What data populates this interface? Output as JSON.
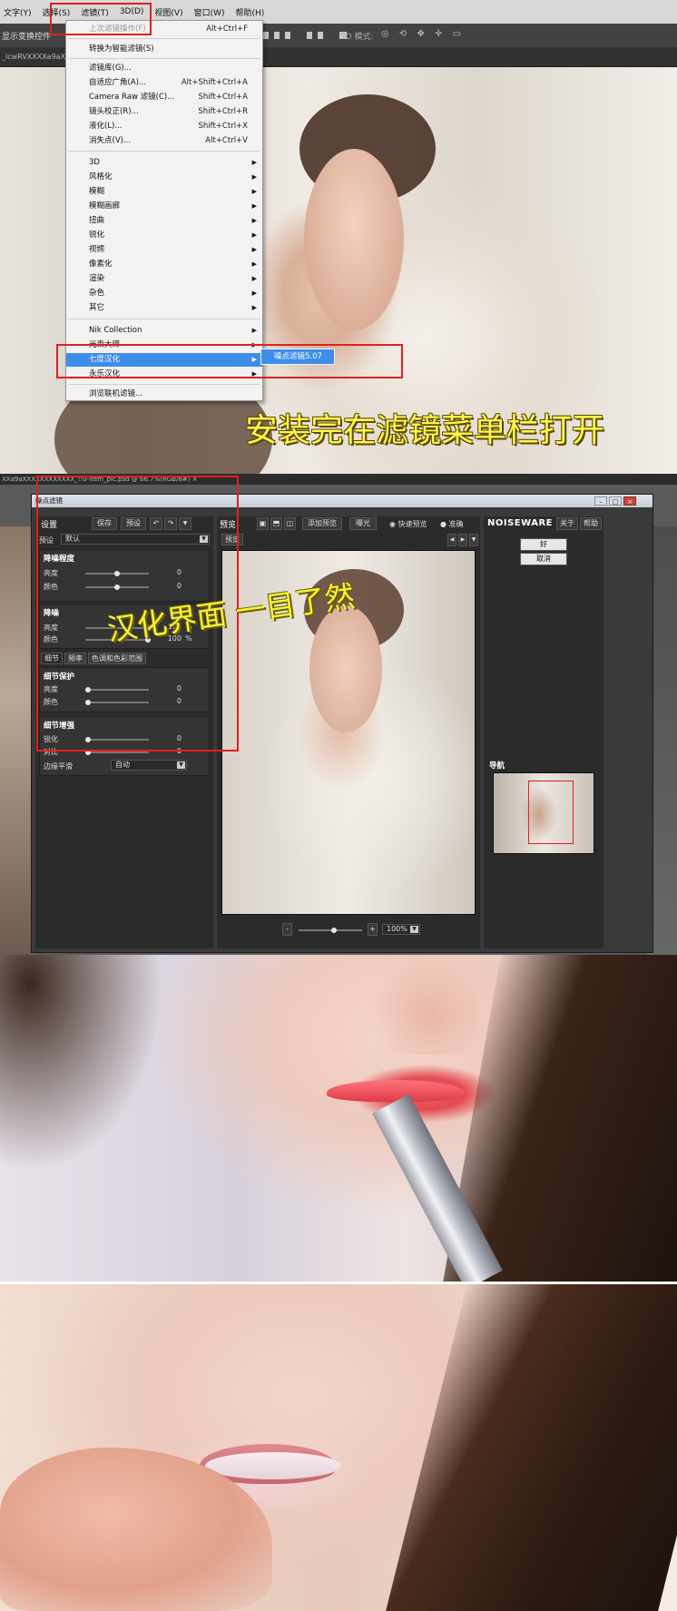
{
  "section1": {
    "menubar": [
      "文字(Y)",
      "选择(S)",
      "滤镜(T)",
      "3D(D)",
      "视图(V)",
      "窗口(W)",
      "帮助(H)"
    ],
    "optbar": {
      "label": "显示变换控件",
      "mode_label": "3D 模式:"
    },
    "doctab": "_lcwRVXXXXa9aXXX",
    "menu": {
      "last_filter": {
        "label": "上次滤镜操作(F)",
        "shortcut": "Alt+Ctrl+F"
      },
      "smart": "转换为智能滤镜(S)",
      "gallery": "滤镜库(G)...",
      "adaptive": {
        "label": "自适应广角(A)...",
        "shortcut": "Alt+Shift+Ctrl+A"
      },
      "camera_raw": {
        "label": "Camera Raw 滤镜(C)...",
        "shortcut": "Shift+Ctrl+A"
      },
      "lens": {
        "label": "镜头校正(R)...",
        "shortcut": "Shift+Ctrl+R"
      },
      "liquify": {
        "label": "液化(L)...",
        "shortcut": "Shift+Ctrl+X"
      },
      "vanish": {
        "label": "消失点(V)...",
        "shortcut": "Alt+Ctrl+V"
      },
      "groups": [
        "3D",
        "风格化",
        "模糊",
        "模糊画廊",
        "扭曲",
        "锐化",
        "视频",
        "像素化",
        "渲染",
        "杂色",
        "其它"
      ],
      "plugins": [
        "Nik Collection",
        "光束大师",
        "七度汉化",
        "永乐汉化"
      ],
      "browse": "浏览联机滤镜..."
    },
    "submenu": "噪点滤镜5.07",
    "caption": "安装完在滤镜菜单栏打开"
  },
  "section2": {
    "tabbar": "XXa9aXXXXXXXXXXXX_!!0-item_pic.psd @ 66.7%(RGB/8#)  ×",
    "title": "噪点滤镜",
    "win_buttons": [
      "–",
      "□",
      "×"
    ],
    "left": {
      "heading": "设置",
      "save": "保存",
      "preset_btn": "预设",
      "preset_label": "预设",
      "preset_value": "默认",
      "noise_level": {
        "title": "降噪程度",
        "rows": [
          {
            "label": "亮度",
            "value": "0"
          },
          {
            "label": "颜色",
            "value": "0"
          }
        ]
      },
      "noise_reduction": {
        "title": "降噪",
        "rows": [
          {
            "label": "亮度",
            "value": "100",
            "unit": "%"
          },
          {
            "label": "颜色",
            "value": "100",
            "unit": "%"
          }
        ]
      },
      "tabs": [
        "细节",
        "频率",
        "色调和色彩范围"
      ],
      "detail_protect": {
        "title": "细节保护",
        "rows": [
          {
            "label": "亮度",
            "value": "0"
          },
          {
            "label": "颜色",
            "value": "0"
          }
        ]
      },
      "detail_enhance": {
        "title": "细节增强",
        "rows": [
          {
            "label": "锐化",
            "value": "0"
          },
          {
            "label": "对比",
            "value": "0"
          }
        ]
      },
      "edge_label": "边缘平滑",
      "edge_value": "自动"
    },
    "center": {
      "heading": "预览",
      "add_preview": "添加预览",
      "exposure": "曝光",
      "fast": "快速预览",
      "accurate": "准确",
      "tab": "预览",
      "zoom": "100%"
    },
    "right": {
      "brand": "NOISEWARE 5",
      "about": "关于",
      "help": "帮助",
      "ok": "好",
      "cancel": "取消",
      "nav": "导航"
    },
    "caption": "汉化界面  一目了然"
  },
  "colors": {
    "highlight": "#3d8ee8",
    "annotation": "#e02020",
    "caption": "#fff44f"
  }
}
